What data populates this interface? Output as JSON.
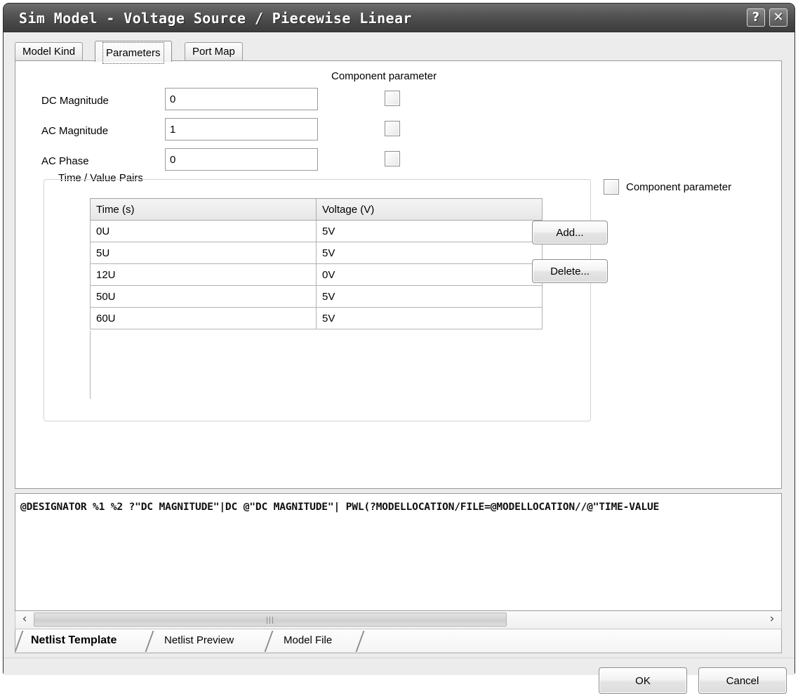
{
  "window": {
    "title": "Sim Model - Voltage Source / Piecewise Linear",
    "help_label": "?",
    "close_label": "✕"
  },
  "tabs": [
    {
      "label": "Model Kind",
      "active": false
    },
    {
      "label": "Parameters",
      "active": true
    },
    {
      "label": "Port Map",
      "active": false
    }
  ],
  "parameters": {
    "component_parameter_header": "Component parameter",
    "fields": [
      {
        "label": "DC Magnitude",
        "value": "0",
        "checked": false
      },
      {
        "label": "AC Magnitude",
        "value": "1",
        "checked": false
      },
      {
        "label": "AC Phase",
        "value": "0",
        "checked": false
      }
    ],
    "component_parameter_checkbox_label": "Component parameter",
    "component_parameter_checked": false
  },
  "time_value_pairs": {
    "caption": "Time / Value Pairs",
    "columns": [
      "Time (s)",
      "Voltage (V)"
    ],
    "rows": [
      [
        "0U",
        "5V"
      ],
      [
        "5U",
        "5V"
      ],
      [
        "12U",
        "0V"
      ],
      [
        "50U",
        "5V"
      ],
      [
        "60U",
        "5V"
      ]
    ],
    "add_button": "Add...",
    "delete_button": "Delete..."
  },
  "netlist": {
    "text": "@DESIGNATOR %1 %2 ?\"DC MAGNITUDE\"|DC @\"DC MAGNITUDE\"| PWL(?MODELLOCATION/FILE=@MODELLOCATION//@\"TIME-VALUE",
    "scroll_left_icon": "‹",
    "scroll_right_icon": "›"
  },
  "bottom_tabs": [
    {
      "label": "Netlist Template",
      "active": true
    },
    {
      "label": "Netlist Preview",
      "active": false
    },
    {
      "label": "Model File",
      "active": false
    }
  ],
  "footer": {
    "ok_label": "OK",
    "cancel_label": "Cancel"
  },
  "colors": {
    "titlebar": "#4a4a4a",
    "dialog_background": "#ececec",
    "panel_background": "#ffffff"
  }
}
